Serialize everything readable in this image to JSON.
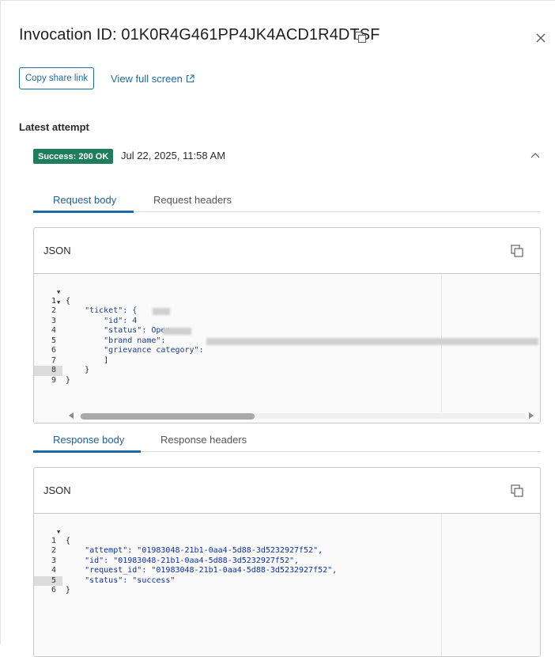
{
  "header": {
    "title": "Invocation ID: 01K0R4G461PP4JK4ACD1R4DTSF",
    "copy_icon": "copy-icon",
    "close_icon": "close-icon"
  },
  "actions": {
    "copy_share_link": "Copy share link",
    "view_full_screen": "View full screen",
    "external_icon": "external-link-icon"
  },
  "latest_attempt": {
    "heading": "Latest attempt",
    "status_badge": "Success: 200 OK",
    "timestamp": "Jul 22, 2025, 11:58 AM",
    "status_color": "#1e7d5a"
  },
  "request": {
    "tabs": [
      "Request body",
      "Request headers"
    ],
    "active_tab": "Request body",
    "box_label": "JSON",
    "lines": [
      {
        "n": "1",
        "fold": true,
        "text": "{"
      },
      {
        "n": "2",
        "fold": true,
        "text": "    \"ticket\": {"
      },
      {
        "n": "3",
        "fold": false,
        "text": "        \"id\": 4"
      },
      {
        "n": "4",
        "fold": false,
        "text": "        \"status\": Open ,"
      },
      {
        "n": "5",
        "fold": false,
        "text": "        \"brand name\":"
      },
      {
        "n": "6",
        "fold": false,
        "text": "        \"grievance category\": "
      },
      {
        "n": "7",
        "fold": false,
        "text": "        ]"
      },
      {
        "n": "8",
        "fold": false,
        "text": "    }"
      },
      {
        "n": "9",
        "fold": false,
        "text": "}"
      }
    ]
  },
  "response": {
    "tabs": [
      "Response body",
      "Response headers"
    ],
    "active_tab": "Response body",
    "box_label": "JSON",
    "lines": [
      {
        "n": "1",
        "fold": true,
        "text": "{"
      },
      {
        "n": "2",
        "fold": false,
        "text": "    \"attempt\": \"01983048-21b1-0aa4-5d88-3d5232927f52\","
      },
      {
        "n": "3",
        "fold": false,
        "text": "    \"id\": \"01983048-21b1-0aa4-5d88-3d5232927f52\","
      },
      {
        "n": "4",
        "fold": false,
        "text": "    \"request_id\": \"01983048-21b1-0aa4-5d88-3d5232927f52\","
      },
      {
        "n": "5",
        "fold": false,
        "text": "    \"status\": \"success\""
      },
      {
        "n": "6",
        "fold": false,
        "text": "}"
      }
    ]
  },
  "colors": {
    "accent": "#1f6aa5",
    "success": "#1e7d5a"
  }
}
